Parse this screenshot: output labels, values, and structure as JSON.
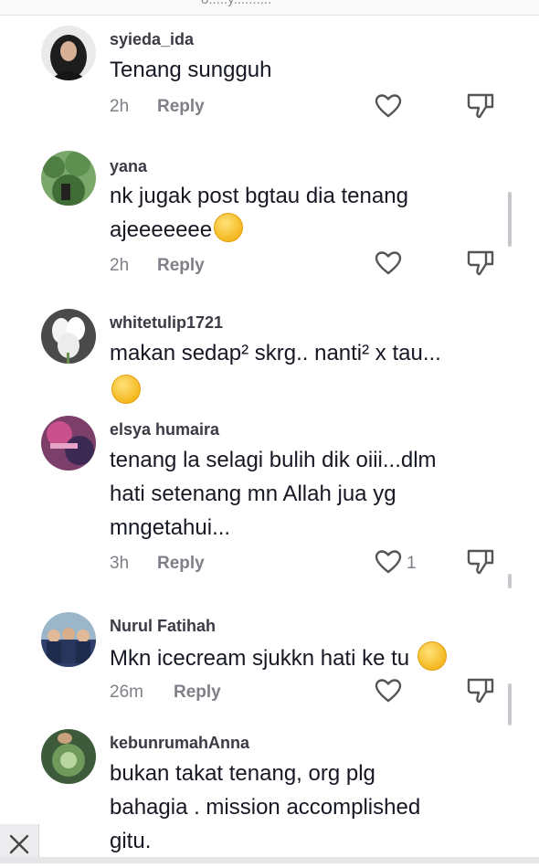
{
  "page": {
    "url_fragment": "o.....y.........."
  },
  "reply_label": "Reply",
  "comments": [
    {
      "username": "syieda_ida",
      "text": "Tenang sungguh",
      "time": "2h",
      "likes": ""
    },
    {
      "username": "yana",
      "text": "nk jugak post bgtau dia tenang\najeeeeeee",
      "time": "2h",
      "likes": ""
    },
    {
      "username": "whitetulip1721",
      "text": "makan sedap² skrg.. nanti² x tau...",
      "time": "",
      "likes": ""
    },
    {
      "username": "elsya humaira",
      "text": "tenang la selagi bulih dik oiii...dlm\nhati setenang mn Allah jua yg\nmngetahui...",
      "time": "3h",
      "likes": "1"
    },
    {
      "username": "Nurul Fatihah",
      "text": "Mkn icecream sjukkn hati ke tu",
      "time": "26m",
      "likes": ""
    },
    {
      "username": "kebunrumahAnna",
      "text": "bukan takat tenang, org plg\nbahagia . mission accomplished\ngitu.",
      "time": "",
      "likes": ""
    }
  ],
  "icons": {
    "heart": "heart-outline-icon",
    "dislike": "thumbs-down-icon",
    "close": "close-icon"
  },
  "colors": {
    "username": "#3a3b44",
    "text": "#161823",
    "meta": "#7f8087"
  }
}
